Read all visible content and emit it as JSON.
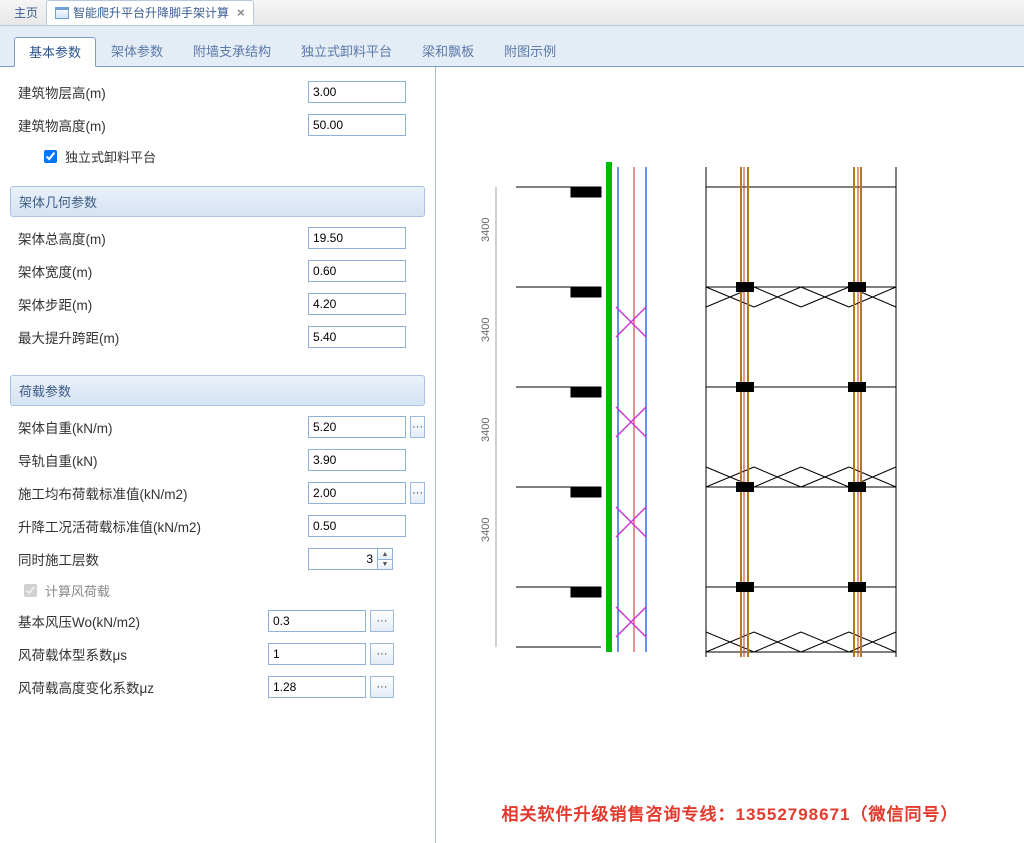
{
  "doc_tabs": {
    "home": "主页",
    "active": "智能爬升平台升降脚手架计算"
  },
  "section_tabs": [
    "基本参数",
    "架体参数",
    "附墙支承结构",
    "独立式卸料平台",
    "梁和飘板",
    "附图示例"
  ],
  "fields": {
    "building_floor_height": {
      "label": "建筑物层高(m)",
      "value": "3.00"
    },
    "building_height": {
      "label": "建筑物高度(m)",
      "value": "50.00"
    },
    "indep_platform": {
      "label": "独立式卸料平台",
      "checked": true
    },
    "geom_header": "架体几何参数",
    "frame_total_height": {
      "label": "架体总高度(m)",
      "value": "19.50"
    },
    "frame_width": {
      "label": "架体宽度(m)",
      "value": "0.60"
    },
    "frame_step": {
      "label": "架体步距(m)",
      "value": "4.20"
    },
    "max_lift_span": {
      "label": "最大提升跨距(m)",
      "value": "5.40"
    },
    "load_header": "荷载参数",
    "frame_self_weight": {
      "label": "架体自重(kN/m)",
      "value": "5.20"
    },
    "rail_self_weight": {
      "label": "导轨自重(kN)",
      "value": "3.90"
    },
    "construct_load": {
      "label": "施工均布荷载标准值(kN/m2)",
      "value": "2.00"
    },
    "lift_live_load": {
      "label": "升降工况活荷载标准值(kN/m2)",
      "value": "0.50"
    },
    "simul_floors": {
      "label": "同时施工层数",
      "value": "3"
    },
    "calc_wind": {
      "label": "计算风荷载",
      "checked": true
    },
    "basic_wind": {
      "label": "基本风压Wo(kN/m2)",
      "value": "0.3"
    },
    "shape_coef": {
      "label": "风荷载体型系数μs",
      "value": "1"
    },
    "height_coef": {
      "label": "风荷载高度变化系数μz",
      "value": "1.28"
    }
  },
  "dim_labels": [
    "3400",
    "3400",
    "3400",
    "3400"
  ],
  "footer": "相关软件升级销售咨询专线：13552798671（微信同号）",
  "ellipsis": "···"
}
